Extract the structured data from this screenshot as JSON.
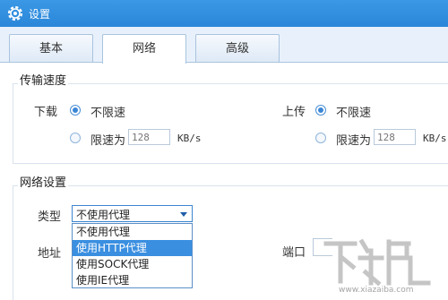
{
  "window": {
    "title": "设置",
    "icon": "gear-icon"
  },
  "tabs": [
    {
      "label": "基本",
      "active": false
    },
    {
      "label": "网络",
      "active": true
    },
    {
      "label": "高级",
      "active": false
    }
  ],
  "transfer_speed": {
    "title": "传输速度",
    "download": {
      "label": "下载",
      "unlimited_label": "不限速",
      "limit_label": "限速为",
      "value": "128",
      "unit": "KB/s",
      "selected": "unlimited"
    },
    "upload": {
      "label": "上传",
      "unlimited_label": "不限速",
      "limit_label": "限速为",
      "value": "128",
      "unit": "KB/s",
      "selected": "unlimited"
    }
  },
  "network_settings": {
    "title": "网络设置",
    "type_label": "类型",
    "type_value": "不使用代理",
    "address_label": "地址",
    "port_label": "端口",
    "options": [
      "不使用代理",
      "使用HTTP代理",
      "使用SOCK代理",
      "使用IE代理"
    ],
    "highlighted_option": "使用HTTP代理"
  },
  "watermark": {
    "text": "下载吧",
    "url": "www.xiazaiba.com"
  },
  "colors": {
    "titlebar": "#2e8fe0",
    "accent": "#3b8fe0",
    "panel_bg": "#e8f1fb"
  }
}
